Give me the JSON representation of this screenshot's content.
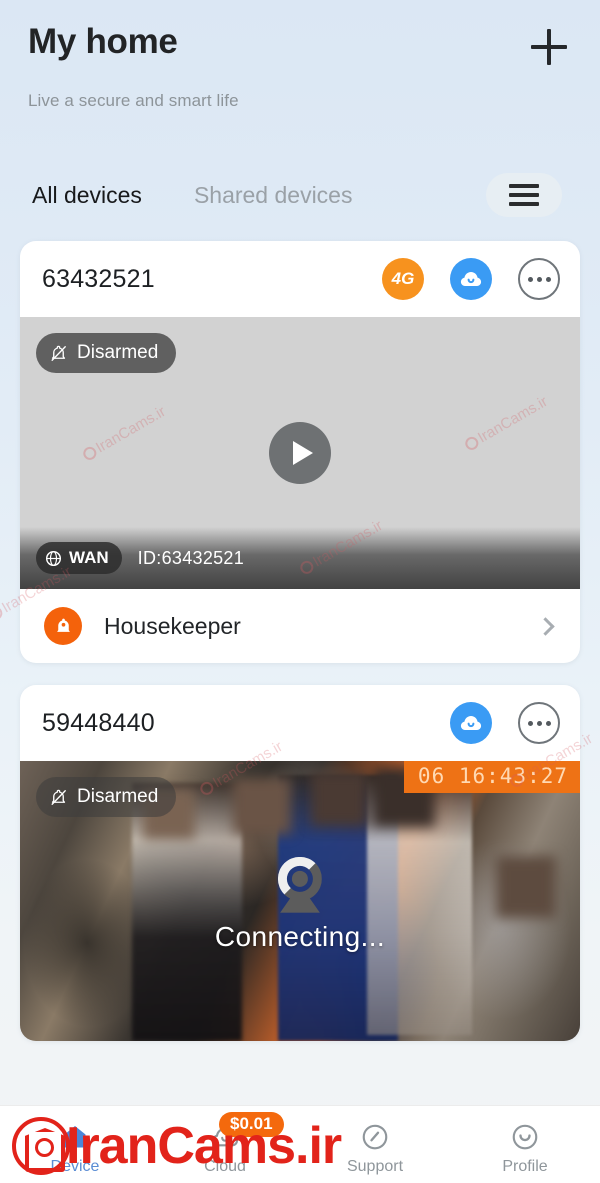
{
  "header": {
    "title": "My home",
    "subtitle": "Live a secure and smart life",
    "add_icon": "plus-icon"
  },
  "tabs": [
    {
      "label": "All devices",
      "active": true
    },
    {
      "label": "Shared devices",
      "active": false
    }
  ],
  "menu_button": {
    "icon": "hamburger-menu-icon"
  },
  "devices": [
    {
      "id": "63432521",
      "badges": {
        "network": "4G",
        "cloud_icon": "cloud-icon",
        "more_icon": "more-options-icon"
      },
      "arm_status": "Disarmed",
      "arm_icon": "bell-slash-icon",
      "play_icon": "play-icon",
      "connection": "WAN",
      "connection_icon": "globe-icon",
      "overlay_id": "ID:63432521",
      "service": {
        "label": "Housekeeper",
        "icon": "bell-icon",
        "chevron": "chevron-right-icon"
      }
    },
    {
      "id": "59448440",
      "badges": {
        "cloud_icon": "cloud-icon",
        "more_icon": "more-options-icon"
      },
      "arm_status": "Disarmed",
      "arm_icon": "bell-slash-icon",
      "timestamp": "06  16:43:27",
      "status_text": "Connecting...",
      "status_icon": "camera-loading-icon"
    }
  ],
  "bottom_nav": [
    {
      "label": "Device",
      "icon": "house-icon",
      "active": true,
      "badge": ""
    },
    {
      "label": "Cloud",
      "icon": "cloud-icon",
      "active": false,
      "badge": "$0.01"
    },
    {
      "label": "Support",
      "icon": "support-icon",
      "active": false,
      "badge": ""
    },
    {
      "label": "Profile",
      "icon": "profile-smiley-icon",
      "active": false,
      "badge": ""
    }
  ],
  "watermark": {
    "text": "IranCams.ir",
    "small_text": "IranCams.ir",
    "color": "#e2231a"
  },
  "colors": {
    "accent_orange": "#f7921e",
    "accent_blue": "#3a9bf4",
    "housekeeper_orange": "#f4620b",
    "nav_active": "#5b8dd4",
    "timestamp_orange": "#ee7215"
  }
}
